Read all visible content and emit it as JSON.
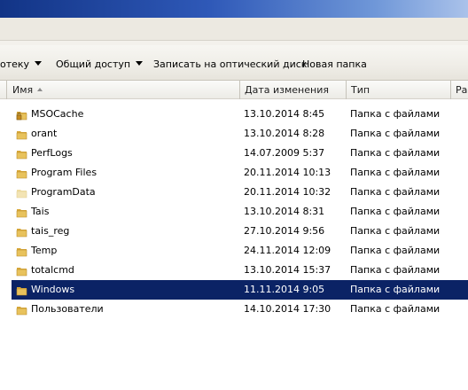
{
  "toolbar": {
    "library_label": "отеку",
    "share_label": "Общий доступ",
    "burn_label": "Записать на оптический диск",
    "new_folder_label": "Новая папка"
  },
  "columns": {
    "name": "Имя",
    "date": "Дата изменения",
    "type": "Тип",
    "size": "Ра"
  },
  "files": [
    {
      "name": "MSOCache",
      "date": "13.10.2014 8:45",
      "type": "Папка с файлами",
      "icon": "locked-folder-icon",
      "selected": false
    },
    {
      "name": "orant",
      "date": "13.10.2014 8:28",
      "type": "Папка с файлами",
      "icon": "folder-icon",
      "selected": false
    },
    {
      "name": "PerfLogs",
      "date": "14.07.2009 5:37",
      "type": "Папка с файлами",
      "icon": "folder-icon",
      "selected": false
    },
    {
      "name": "Program Files",
      "date": "20.11.2014 10:13",
      "type": "Папка с файлами",
      "icon": "folder-icon",
      "selected": false
    },
    {
      "name": "ProgramData",
      "date": "20.11.2014 10:32",
      "type": "Папка с файлами",
      "icon": "hidden-folder-icon",
      "selected": false
    },
    {
      "name": "Tais",
      "date": "13.10.2014 8:31",
      "type": "Папка с файлами",
      "icon": "folder-icon",
      "selected": false
    },
    {
      "name": "tais_reg",
      "date": "27.10.2014 9:56",
      "type": "Папка с файлами",
      "icon": "folder-icon",
      "selected": false
    },
    {
      "name": "Temp",
      "date": "24.11.2014 12:09",
      "type": "Папка с файлами",
      "icon": "folder-icon",
      "selected": false
    },
    {
      "name": "totalcmd",
      "date": "13.10.2014 15:37",
      "type": "Папка с файлами",
      "icon": "folder-icon",
      "selected": false
    },
    {
      "name": "Windows",
      "date": "11.11.2014 9:05",
      "type": "Папка с файлами",
      "icon": "folder-icon",
      "selected": true
    },
    {
      "name": "Пользователи",
      "date": "14.10.2014 17:30",
      "type": "Папка с файлами",
      "icon": "folder-icon",
      "selected": false
    }
  ],
  "colors": {
    "selection": "#0b2365",
    "folder": "#e8c25c"
  }
}
